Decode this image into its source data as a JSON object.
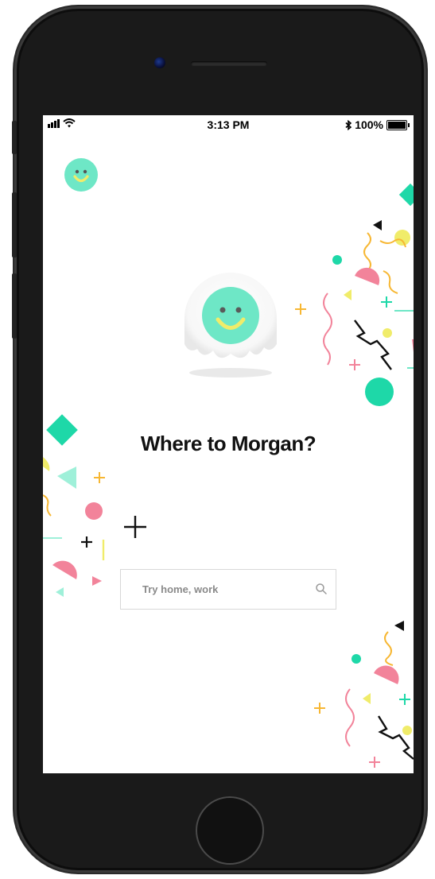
{
  "status_bar": {
    "time": "3:13 PM",
    "battery": "100%",
    "icons": [
      "signal-icon",
      "wifi-icon",
      "bluetooth-icon",
      "battery-icon"
    ]
  },
  "profile": {
    "icon": "smiley-avatar-icon"
  },
  "hero": {
    "icon": "smiley-mascot-icon"
  },
  "greeting": "Where to Morgan?",
  "search": {
    "placeholder": "Try home, work",
    "value": "",
    "icon": "search-icon"
  },
  "colors": {
    "mint": "#6ee7c6",
    "teal": "#1ed8a8",
    "yellow": "#f0ec6a",
    "pink": "#f2839a",
    "orange": "#f7b733"
  }
}
